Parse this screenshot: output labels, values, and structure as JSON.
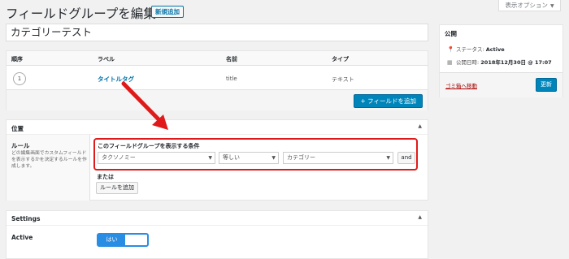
{
  "screen_options": "表示オプション",
  "page_title": "フィールドグループを編集",
  "add_new": "新規追加",
  "group_title": "カテゴリーテスト",
  "fields": {
    "headers": [
      "順序",
      "ラベル",
      "名前",
      "タイプ"
    ],
    "row": {
      "order": "1",
      "label": "タイトルタグ",
      "name": "title",
      "type": "テキスト"
    },
    "add_button": "+ フィールドを追加"
  },
  "location": {
    "heading": "位置",
    "rules_label": "ルール",
    "rules_desc": "どの編集画面でカスタムフィールドを表示するかを決定するルールを作成します。",
    "group_title": "このフィールドグループを表示する条件",
    "param": "タクソノミー",
    "operator": "等しい",
    "value": "カテゴリー",
    "and_button": "and",
    "or_label": "または",
    "add_rule_button": "ルールを追加"
  },
  "settings": {
    "heading": "Settings",
    "active_label": "Active",
    "toggle_on": "はい"
  },
  "publish": {
    "heading": "公開",
    "status_label": "ステータス:",
    "status_value": "Active",
    "date_label": "公開日時:",
    "date_value": "2018年12月30日 @ 17:07",
    "trash_link": "ゴミ箱へ移動",
    "update_button": "更新"
  },
  "colors": {
    "accent": "#0085ba",
    "highlight": "#e01a1a",
    "toggle": "#2a8de4"
  }
}
